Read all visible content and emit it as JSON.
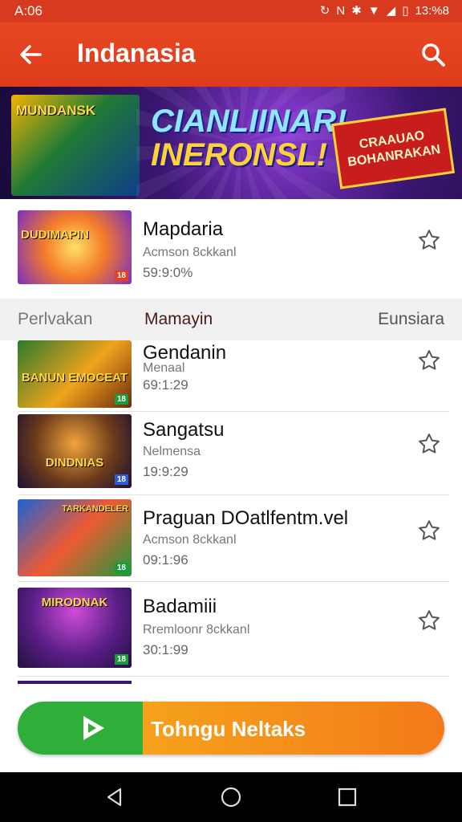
{
  "status": {
    "time": "A:06",
    "icons": [
      "sync-icon",
      "nfc-icon",
      "bluetooth-icon",
      "wifi-icon",
      "signal-icon",
      "battery-icon"
    ],
    "battery": "13:%8"
  },
  "app_bar": {
    "title": "Indanasia",
    "back_icon": "arrow-left-icon",
    "search_icon": "search-icon",
    "color": "#e2411e"
  },
  "banner": {
    "art_text": "MUNDANSK",
    "headline_1": "CIANLIINAR!",
    "headline_2": "INERONSL!",
    "badge": "CRAAUAO BOHANRAKAN"
  },
  "featured": {
    "title": "Mapdaria",
    "subtitle": "Acmson 8ckkanl",
    "meta": "59:9:0%",
    "art_text": "DUDIMAPIN"
  },
  "section": {
    "left": "Perlvakan",
    "middle": "Mamayin",
    "right": "Eunsiara"
  },
  "items": [
    {
      "title": "Gendanin",
      "subtitle": "Menaal",
      "meta": "69:1:29",
      "art_text": "BANUN EMOCEAT",
      "tag_color": "#1a9a3a"
    },
    {
      "title": "Sangatsu",
      "subtitle": "Nelmensa",
      "meta": "19:9:29",
      "art_text": "DINDNIAS",
      "tag_color": "#2d5bd8"
    },
    {
      "title": "Praguan DOatlfentm.vel",
      "subtitle": "Acmson 8ckkanl",
      "meta": "09:1:96",
      "art_text": "TARKANDELER",
      "tag_color": "#1a9a3a"
    },
    {
      "title": "Badamiii",
      "subtitle": "Rremloonr 8ckkanl",
      "meta": "30:1:99",
      "art_text": "MIRODNAK",
      "tag_color": "#1a9a3a"
    }
  ],
  "cta": {
    "label": "Tohngu Neltaks",
    "play_icon": "play-icon"
  },
  "nav": {
    "back_icon": "nav-back-icon",
    "home_icon": "nav-home-icon",
    "recents_icon": "nav-recents-icon"
  }
}
